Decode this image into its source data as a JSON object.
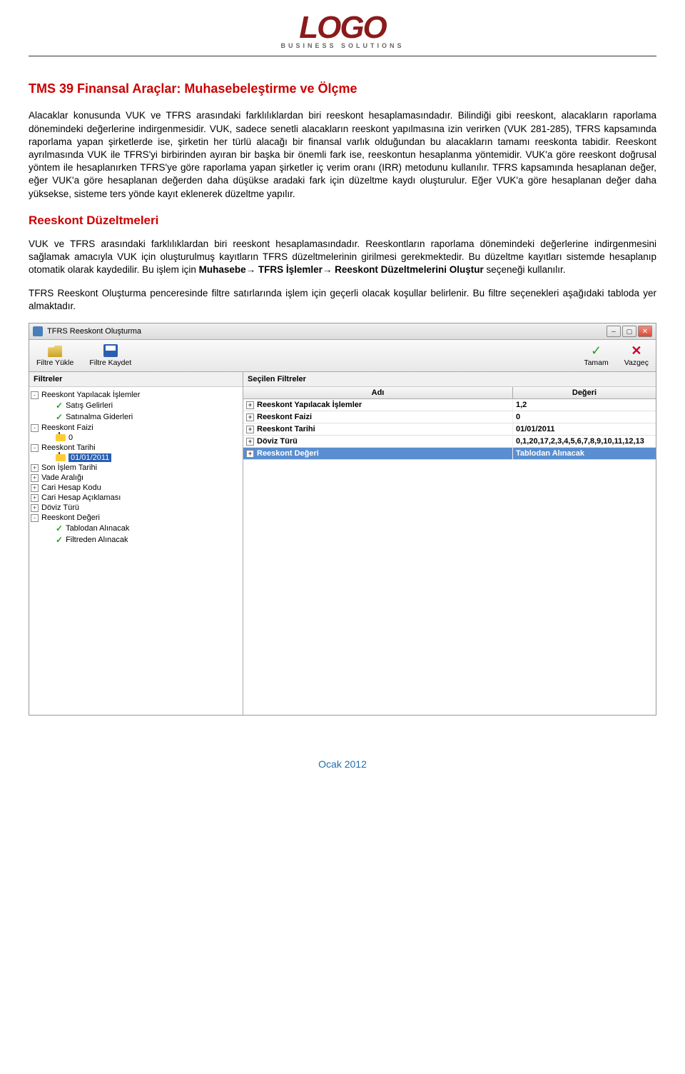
{
  "logo": {
    "main": "LOGO",
    "sub": "BUSINESS SOLUTIONS"
  },
  "doc": {
    "title": "TMS 39 Finansal Araçlar: Muhasebeleştirme ve Ölçme",
    "para1": "Alacaklar konusunda VUK ve TFRS arasındaki farklılıklardan biri reeskont hesaplamasındadır. Bilindiği gibi reeskont, alacakların raporlama dönemindeki değerlerine indirgenmesidir. VUK, sadece senetli alacakların reeskont yapılmasına izin verirken (VUK 281-285), TFRS kapsamında raporlama yapan şirketlerde ise, şirketin her türlü alacağı bir finansal varlık olduğundan bu alacakların tamamı reeskonta tabidir.",
    "para1b": "Reeskont ayrılmasında VUK ile TFRS'yi birbirinden ayıran bir başka bir önemli fark ise, reeskontun hesaplanma yöntemidir. VUK'a göre reeskont doğrusal yöntem ile hesaplanırken TFRS'ye göre raporlama yapan şirketler iç verim oranı (IRR) metodunu kullanılır. TFRS kapsamında hesaplanan değer, eğer VUK'a göre hesaplanan değerden daha düşükse aradaki fark için düzeltme kaydı oluşturulur. Eğer VUK'a göre hesaplanan değer daha yüksekse, sisteme ters yönde kayıt eklenerek düzeltme yapılır.",
    "section2": "Reeskont Düzeltmeleri",
    "para2a": "VUK ve TFRS arasındaki farklılıklardan biri reeskont hesaplamasındadır. Reeskontların raporlama dönemindeki değerlerine indirgenmesini sağlamak amacıyla VUK için oluşturulmuş kayıtların TFRS düzeltmelerinin girilmesi gerekmektedir. Bu düzeltme kayıtları sistemde hesaplanıp otomatik olarak kaydedilir. Bu işlem için ",
    "para2bold": "Muhasebe→ TFRS İşlemler→ Reeskont Düzeltmelerini Oluştur",
    "para2b": " seçeneği kullanılır.",
    "para3": "TFRS Reeskont Oluşturma penceresinde filtre satırlarında işlem için geçerli olacak koşullar belirlenir. Bu filtre seçenekleri aşağıdaki tabloda yer almaktadır."
  },
  "window": {
    "title": "TFRS Reeskont Oluşturma",
    "toolbar": {
      "open": "Filtre Yükle",
      "save": "Filtre Kaydet",
      "ok": "Tamam",
      "cancel": "Vazgeç"
    },
    "left_header": "Filtreler",
    "right_header": "Seçilen Filtreler",
    "grid_cols": {
      "name": "Adı",
      "value": "Değeri"
    },
    "tree": [
      {
        "toggle": "-",
        "depth": 0,
        "icon": "",
        "label": "Reeskont Yapılacak İşlemler"
      },
      {
        "toggle": "",
        "depth": 1,
        "icon": "green",
        "label": "Satış Gelirleri"
      },
      {
        "toggle": "",
        "depth": 1,
        "icon": "green",
        "label": "Satınalma Giderleri"
      },
      {
        "toggle": "-",
        "depth": 0,
        "icon": "",
        "label": "Reeskont Faizi"
      },
      {
        "toggle": "",
        "depth": 1,
        "icon": "yellow",
        "label": "0"
      },
      {
        "toggle": "-",
        "depth": 0,
        "icon": "",
        "label": "Reeskont Tarihi"
      },
      {
        "toggle": "",
        "depth": 1,
        "icon": "yellow",
        "label": "01/01/2011",
        "hl": true
      },
      {
        "toggle": "+",
        "depth": 0,
        "icon": "",
        "label": "Son İşlem Tarihi"
      },
      {
        "toggle": "+",
        "depth": 0,
        "icon": "",
        "label": "Vade Aralığı"
      },
      {
        "toggle": "+",
        "depth": 0,
        "icon": "",
        "label": "Cari Hesap Kodu"
      },
      {
        "toggle": "+",
        "depth": 0,
        "icon": "",
        "label": "Cari Hesap Açıklaması"
      },
      {
        "toggle": "+",
        "depth": 0,
        "icon": "",
        "label": "Döviz Türü"
      },
      {
        "toggle": "-",
        "depth": 0,
        "icon": "",
        "label": "Reeskont Değeri"
      },
      {
        "toggle": "",
        "depth": 1,
        "icon": "green",
        "label": "Tablodan Alınacak"
      },
      {
        "toggle": "",
        "depth": 1,
        "icon": "green",
        "label": "Filtreden Alınacak"
      }
    ],
    "grid_rows": [
      {
        "name": "Reeskont Yapılacak İşlemler",
        "value": "1,2",
        "selected": false
      },
      {
        "name": "Reeskont Faizi",
        "value": "0",
        "selected": false
      },
      {
        "name": "Reeskont Tarihi",
        "value": "01/01/2011",
        "selected": false
      },
      {
        "name": "Döviz Türü",
        "value": "0,1,20,17,2,3,4,5,6,7,8,9,10,11,12,13",
        "selected": false
      },
      {
        "name": "Reeskont Değeri",
        "value": "Tablodan Alınacak",
        "selected": true
      }
    ]
  },
  "footer": "Ocak 2012"
}
